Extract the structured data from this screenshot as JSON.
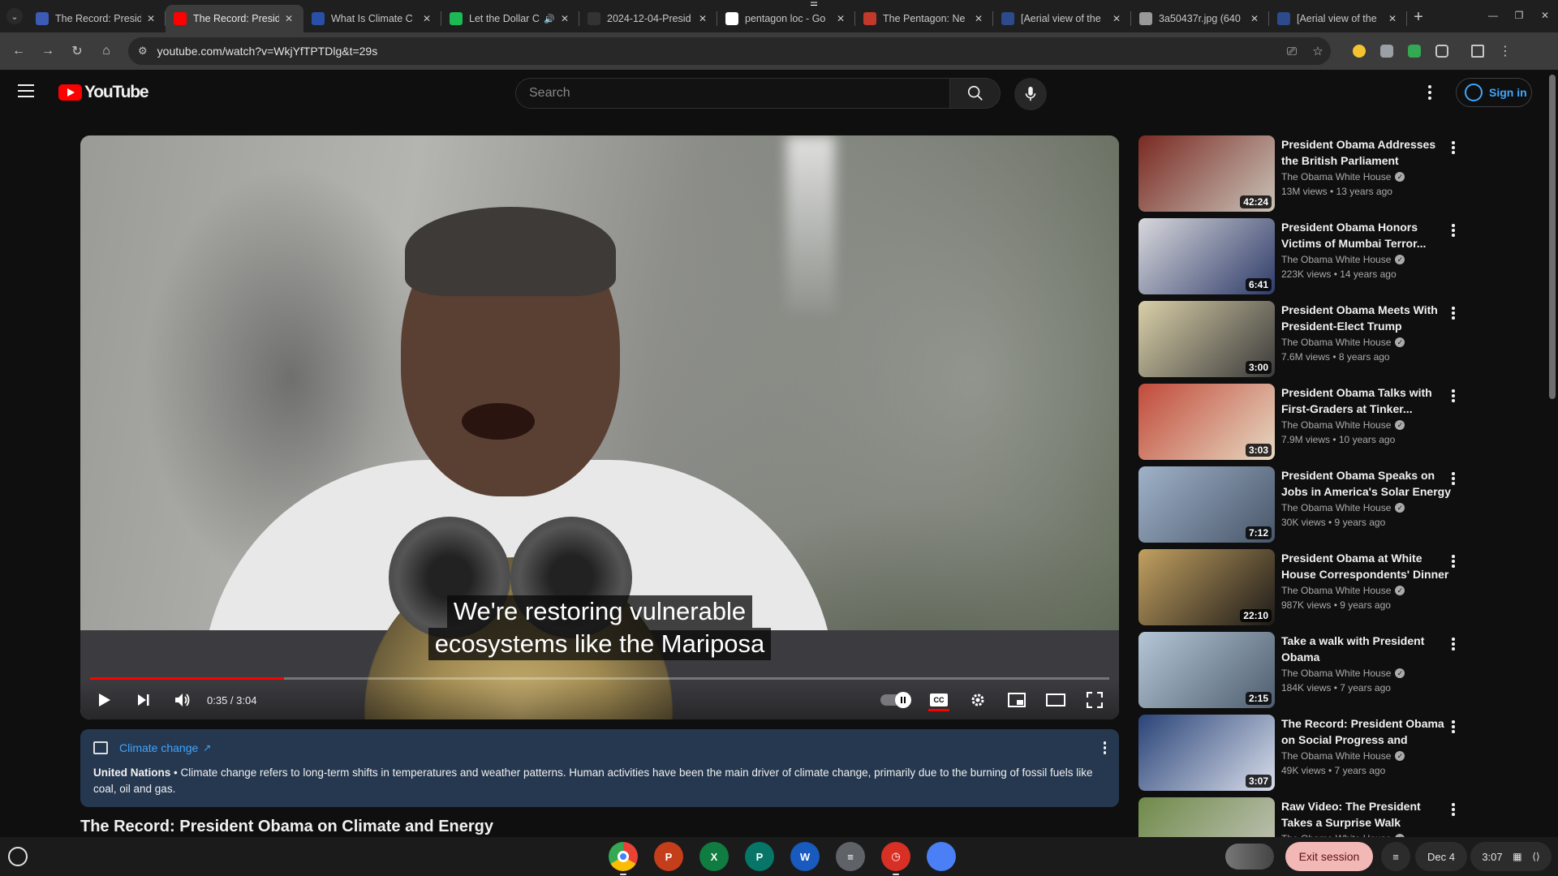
{
  "browser": {
    "tabs": [
      {
        "title": "The Record: Presid",
        "favicon_color": "#3b5bb5",
        "active": false
      },
      {
        "title": "The Record: Presid",
        "favicon_color": "#ff0000",
        "active": true
      },
      {
        "title": "What Is Climate C",
        "favicon_color": "#2a4fa8",
        "active": false
      },
      {
        "title": "Let the Dollar C",
        "favicon_color": "#1db954",
        "active": false
      },
      {
        "title": "2024-12-04-Presid",
        "favicon_color": "#333333",
        "active": false
      },
      {
        "title": "pentagon loc - Go",
        "favicon_color": "#ffffff",
        "active": false
      },
      {
        "title": "The Pentagon: Ne",
        "favicon_color": "#c0392b",
        "active": false
      },
      {
        "title": "[Aerial view of the",
        "favicon_color": "#2c4a8c",
        "active": false
      },
      {
        "title": "3a50437r.jpg (640",
        "favicon_color": "#999999",
        "active": false
      },
      {
        "title": "[Aerial view of the",
        "favicon_color": "#2c4a8c",
        "active": false
      }
    ],
    "url": "youtube.com/watch?v=WkjYfTPTDlg&t=29s"
  },
  "youtube": {
    "logo_text": "YouTube",
    "search_placeholder": "Search",
    "sign_in": "Sign in"
  },
  "player": {
    "caption_line1": "We're restoring vulnerable",
    "caption_line2": "ecosystems like the Mariposa",
    "time": "0:35 / 3:04",
    "played_fraction": 0.19,
    "buffered_fraction": 0.19
  },
  "info_panel": {
    "topic": "Climate change",
    "source": "United Nations",
    "text": " • Climate change refers to long-term shifts in temperatures and weather patterns. Human activities have been the main driver of climate change, primarily due to the burning of fossil fuels like coal, oil and gas."
  },
  "video_title": "The Record: President Obama on Climate and Energy",
  "recommendations": [
    {
      "title": "President Obama Addresses the British Parliament",
      "channel": "The Obama White House",
      "meta": "13M views  •  13 years ago",
      "duration": "42:24",
      "thumb_colors": [
        "#7a2a22",
        "#c9c2b8"
      ]
    },
    {
      "title": "President Obama Honors Victims of Mumbai Terror...",
      "channel": "The Obama White House",
      "meta": "223K views  •  14 years ago",
      "duration": "6:41",
      "thumb_colors": [
        "#d8d8dc",
        "#2f3c6a"
      ]
    },
    {
      "title": "President Obama Meets With President-Elect Trump",
      "channel": "The Obama White House",
      "meta": "7.6M views  •  8 years ago",
      "duration": "3:00",
      "thumb_colors": [
        "#d9cfa8",
        "#3a3a3a"
      ]
    },
    {
      "title": "President Obama Talks with First-Graders at Tinker...",
      "channel": "The Obama White House",
      "meta": "7.9M views  •  10 years ago",
      "duration": "3:03",
      "thumb_colors": [
        "#c24a3a",
        "#e6d9c2"
      ]
    },
    {
      "title": "President Obama Speaks on Jobs in America's Solar Energy",
      "channel": "The Obama White House",
      "meta": "30K views  •  9 years ago",
      "duration": "7:12",
      "thumb_colors": [
        "#9fb2c8",
        "#49566a"
      ]
    },
    {
      "title": "President Obama at White House Correspondents' Dinner",
      "channel": "The Obama White House",
      "meta": "987K views  •  9 years ago",
      "duration": "22:10",
      "thumb_colors": [
        "#c2a060",
        "#1c1a18"
      ]
    },
    {
      "title": "Take a walk with President Obama",
      "channel": "The Obama White House",
      "meta": "184K views  •  7 years ago",
      "duration": "2:15",
      "thumb_colors": [
        "#b5c6d6",
        "#4e5e6e"
      ]
    },
    {
      "title": "The Record: President Obama on Social Progress and Equality",
      "channel": "The Obama White House",
      "meta": "49K views  •  7 years ago",
      "duration": "3:07",
      "thumb_colors": [
        "#2a4478",
        "#d8ddea"
      ]
    },
    {
      "title": "Raw Video: The President Takes a Surprise Walk",
      "channel": "The Obama White House",
      "meta": "",
      "duration": "",
      "thumb_colors": [
        "#6f8a4a",
        "#c8c8c0"
      ]
    }
  ],
  "shelf": {
    "exit_session": "Exit session",
    "date": "Dec 4",
    "time": "3:07",
    "apps": [
      {
        "name": "chrome",
        "color": "#4285f4",
        "label": ""
      },
      {
        "name": "powerpoint",
        "color": "#c43e1c",
        "label": "P"
      },
      {
        "name": "excel",
        "color": "#107c41",
        "label": "X"
      },
      {
        "name": "publisher",
        "color": "#077568",
        "label": "P"
      },
      {
        "name": "word",
        "color": "#185abd",
        "label": "W"
      },
      {
        "name": "docs",
        "color": "#5f6368",
        "label": "≡"
      },
      {
        "name": "clock",
        "color": "#d93025",
        "label": "◷"
      },
      {
        "name": "files",
        "color": "#4a7ff5",
        "label": ""
      }
    ]
  }
}
